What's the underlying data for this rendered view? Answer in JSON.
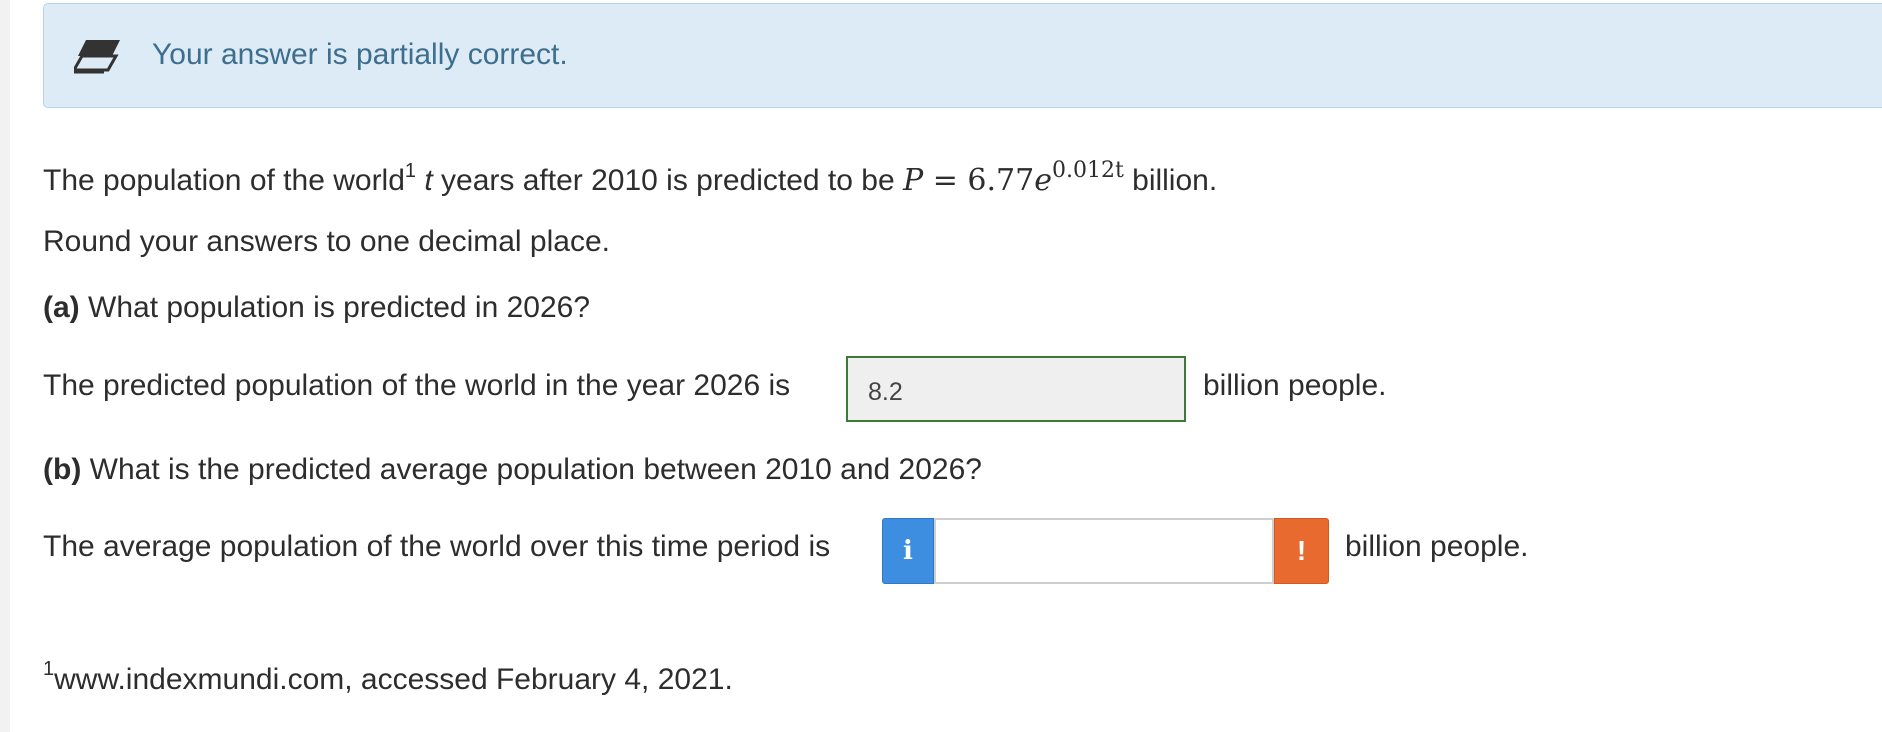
{
  "feedback": {
    "icon": "eraser-icon",
    "message": "Your answer is partially correct."
  },
  "problem": {
    "intro_text_1": "The population of the world",
    "footnote_ref": "1",
    "intro_var": "t",
    "intro_text_2": " years after 2010 is predicted to be ",
    "formula_lhs": "P",
    "formula_eq": " = ",
    "formula_coeff": "6.77",
    "formula_base": "e",
    "formula_exponent": "0.012t",
    "intro_text_3": " billion.",
    "rounding_instruction": "Round your answers to one decimal place."
  },
  "part_a": {
    "label": "(a)",
    "question": " What population is predicted in 2026?",
    "prompt": "The predicted population of the world in the year 2026 is",
    "answer_value": "8.2",
    "unit": "billion people."
  },
  "part_b": {
    "label": "(b)",
    "question": " What is the predicted average population between 2010 and 2026?",
    "prompt": "The average population of the world over this time period is",
    "info_icon": "info-icon",
    "info_glyph": "i",
    "answer_value": "",
    "warning_icon": "warning-icon",
    "warning_glyph": "!",
    "unit": "billion people."
  },
  "footnote": {
    "mark": "1",
    "text": "www.indexmundi.com, accessed February 4, 2021."
  },
  "colors": {
    "banner_bg": "#ddebf6",
    "banner_text": "#3d6e8e",
    "correct_border": "#3b7a3b",
    "info_blue": "#3d8ee0",
    "warning_orange": "#e96a2f"
  }
}
